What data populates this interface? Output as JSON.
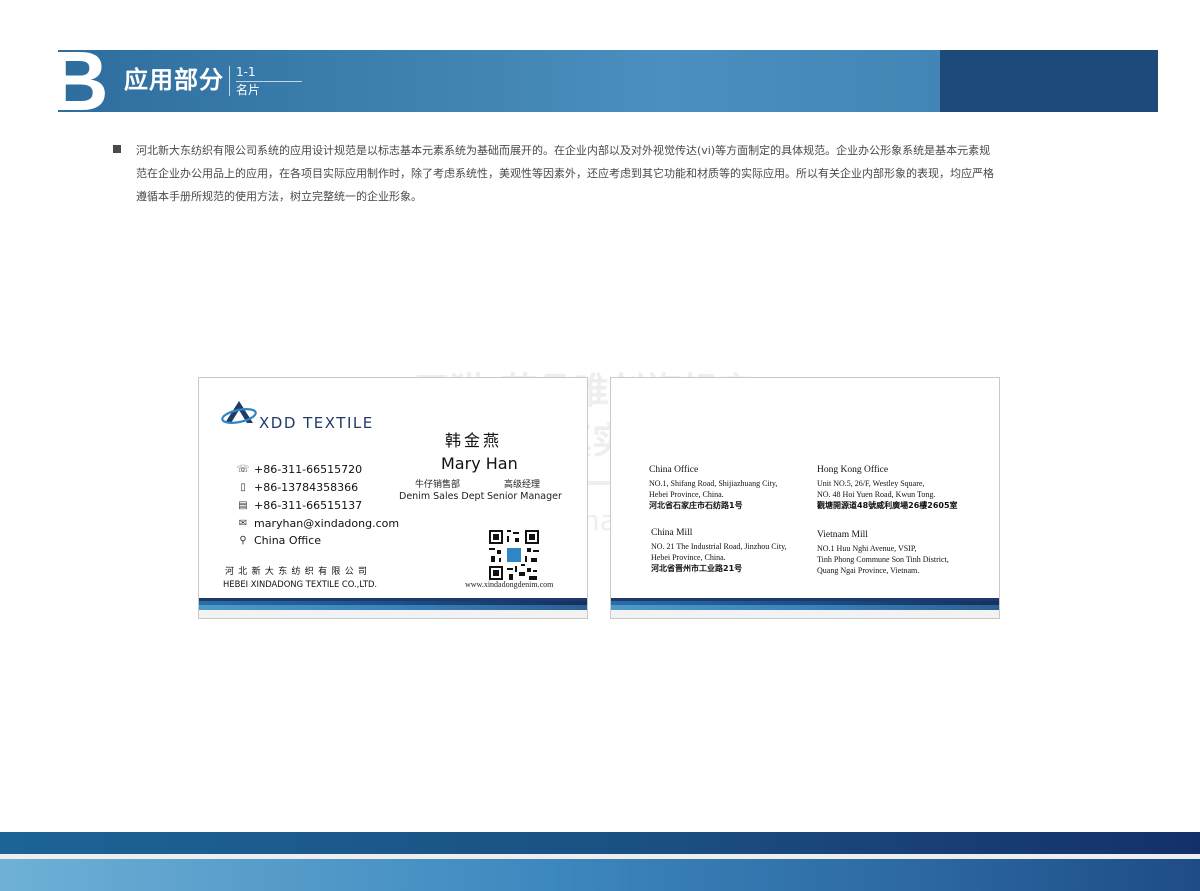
{
  "header": {
    "letter": "B",
    "title": "应用部分",
    "code": "1-1",
    "subtitle": "名片"
  },
  "intro": "河北新大东纺织有限公司系统的应用设计规范是以标志基本元素系统为基础而展开的。在企业内部以及对外视觉传达(vi)等方面制定的具体规范。企业办公形象系统是基本元素规范在企业办公用品上的应用，在各项目实际应用制作时，除了考虑系统性，美观性等因素外，还应考虑到其它功能和材质等的实际应用。所以有关企业内部形象的表现，均应严格遵循本手册所规范的使用方法，树立完整统一的企业形象。",
  "watermark": {
    "line1": "天猫-艺品唯创旗舰店",
    "line2": "独家真实案例",
    "line3": "ypwc.tmall.com"
  },
  "front": {
    "logo_text": "XDD TEXTILE",
    "name_cn": "韩金燕",
    "name_en": "Mary Han",
    "dept_cn": "牛仔销售部",
    "title_cn": "高级经理",
    "dept_en": "Denim Sales Dept",
    "title_en": "Senior Manager",
    "contacts": [
      {
        "icon": "phone-icon",
        "text": "+86-311-66515720"
      },
      {
        "icon": "mobile-icon",
        "text": "+86-13784358366"
      },
      {
        "icon": "fax-icon",
        "text": "+86-311-66515137"
      },
      {
        "icon": "email-icon",
        "text": "maryhan@xindadong.com"
      },
      {
        "icon": "location-icon",
        "text": "China Office"
      }
    ],
    "company_cn": "河北新大东纺织有限公司",
    "company_en": "HEBEI XINDADONG TEXTILE CO.,LTD.",
    "website": "www.xindadongdenim.com"
  },
  "back": {
    "offices": [
      {
        "heading": "China Office",
        "lines": [
          "NO.1, Shifang Road, Shijiazhuang City,",
          "Hebei Province, China."
        ],
        "cn": "河北省石家庄市石纺路1号"
      },
      {
        "heading": "Hong Kong Office",
        "lines": [
          "Unit NO.5, 26/F, Westley Square,",
          "NO. 48 Hoi Yuen Road, Kwun Tong."
        ],
        "cn": "觀塘開源道48號威利廣場26樓2605室"
      },
      {
        "heading": "China Mill",
        "lines": [
          "NO. 21 The Industrial Road, Jinzhou City,",
          "Hebei Province, China."
        ],
        "cn": "河北省晋州市工业路21号"
      },
      {
        "heading": "Vietnam Mill",
        "lines": [
          "NO.1 Huu Nghi Avenue, VSIP,",
          "Tinh Phong Commune Son Tinh District,",
          "Quang Ngai Province, Vietnam."
        ],
        "cn": ""
      }
    ]
  },
  "colors": {
    "header_blue": "#3c7fb0",
    "header_dark": "#1d4a78",
    "brand_navy": "#1f3b66",
    "stripe_light": "#4d9acb"
  }
}
